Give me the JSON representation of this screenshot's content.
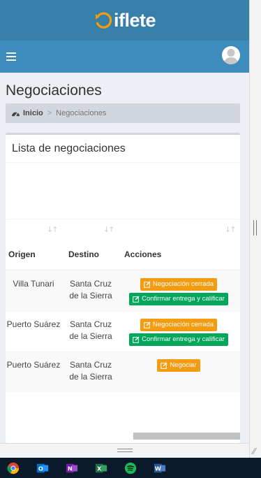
{
  "brand": {
    "logo_text": "iflete",
    "colors": {
      "header_dark": "#367fa9",
      "navbar": "#3c8dbc",
      "warning": "#f39c12",
      "success": "#00a65a"
    }
  },
  "navbar": {
    "menu_icon": "hamburger-icon",
    "avatar_icon": "user-avatar-icon"
  },
  "page": {
    "title": "Negociaciones"
  },
  "breadcrumb": {
    "home_icon": "tachometer-icon",
    "home": "Inicio",
    "separator": ">",
    "current": "Negociaciones"
  },
  "box": {
    "title": "Lista de negociaciones"
  },
  "table": {
    "sort_icon": "sort-icon",
    "columns": [
      "Origen",
      "Destino",
      "Acciones"
    ],
    "rows": [
      {
        "origen": "Villa Tunari",
        "destino": "Santa Cruz de la Sierra",
        "actions": [
          "Negociación cerrada",
          "Confirmar entrega y calificar"
        ]
      },
      {
        "origen": "Puerto Suárez",
        "destino": "Santa Cruz de la Sierra",
        "actions": [
          "Negociación cerrada",
          "Confirmar entrega y calificar"
        ]
      },
      {
        "origen": "Puerto Suárez",
        "destino": "Santa Cruz de la Sierra",
        "actions": [
          "Negociar"
        ]
      }
    ]
  },
  "taskbar": {
    "items": [
      "chrome-icon",
      "outlook-icon",
      "onenote-icon",
      "excel-icon",
      "spotify-icon",
      "word-icon"
    ]
  }
}
